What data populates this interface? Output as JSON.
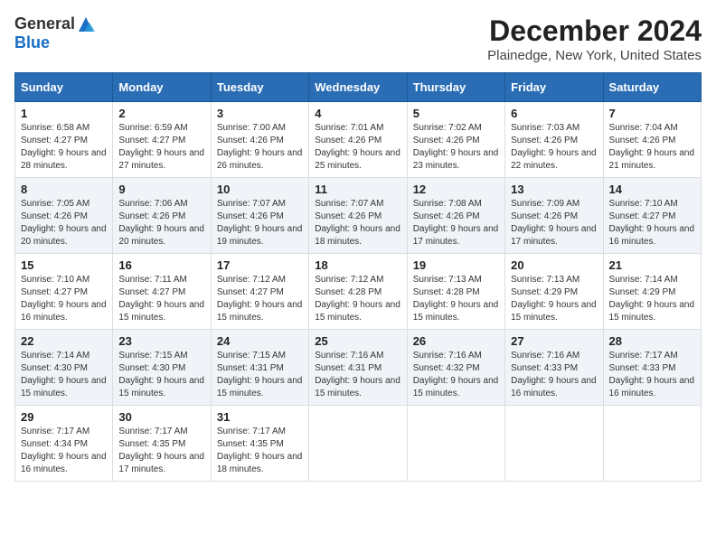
{
  "logo": {
    "general": "General",
    "blue": "Blue"
  },
  "title": "December 2024",
  "subtitle": "Plainedge, New York, United States",
  "days_of_week": [
    "Sunday",
    "Monday",
    "Tuesday",
    "Wednesday",
    "Thursday",
    "Friday",
    "Saturday"
  ],
  "weeks": [
    [
      {
        "day": "1",
        "sunrise": "6:58 AM",
        "sunset": "4:27 PM",
        "daylight": "9 hours and 28 minutes."
      },
      {
        "day": "2",
        "sunrise": "6:59 AM",
        "sunset": "4:27 PM",
        "daylight": "9 hours and 27 minutes."
      },
      {
        "day": "3",
        "sunrise": "7:00 AM",
        "sunset": "4:26 PM",
        "daylight": "9 hours and 26 minutes."
      },
      {
        "day": "4",
        "sunrise": "7:01 AM",
        "sunset": "4:26 PM",
        "daylight": "9 hours and 25 minutes."
      },
      {
        "day": "5",
        "sunrise": "7:02 AM",
        "sunset": "4:26 PM",
        "daylight": "9 hours and 23 minutes."
      },
      {
        "day": "6",
        "sunrise": "7:03 AM",
        "sunset": "4:26 PM",
        "daylight": "9 hours and 22 minutes."
      },
      {
        "day": "7",
        "sunrise": "7:04 AM",
        "sunset": "4:26 PM",
        "daylight": "9 hours and 21 minutes."
      }
    ],
    [
      {
        "day": "8",
        "sunrise": "7:05 AM",
        "sunset": "4:26 PM",
        "daylight": "9 hours and 20 minutes."
      },
      {
        "day": "9",
        "sunrise": "7:06 AM",
        "sunset": "4:26 PM",
        "daylight": "9 hours and 20 minutes."
      },
      {
        "day": "10",
        "sunrise": "7:07 AM",
        "sunset": "4:26 PM",
        "daylight": "9 hours and 19 minutes."
      },
      {
        "day": "11",
        "sunrise": "7:07 AM",
        "sunset": "4:26 PM",
        "daylight": "9 hours and 18 minutes."
      },
      {
        "day": "12",
        "sunrise": "7:08 AM",
        "sunset": "4:26 PM",
        "daylight": "9 hours and 17 minutes."
      },
      {
        "day": "13",
        "sunrise": "7:09 AM",
        "sunset": "4:26 PM",
        "daylight": "9 hours and 17 minutes."
      },
      {
        "day": "14",
        "sunrise": "7:10 AM",
        "sunset": "4:27 PM",
        "daylight": "9 hours and 16 minutes."
      }
    ],
    [
      {
        "day": "15",
        "sunrise": "7:10 AM",
        "sunset": "4:27 PM",
        "daylight": "9 hours and 16 minutes."
      },
      {
        "day": "16",
        "sunrise": "7:11 AM",
        "sunset": "4:27 PM",
        "daylight": "9 hours and 15 minutes."
      },
      {
        "day": "17",
        "sunrise": "7:12 AM",
        "sunset": "4:27 PM",
        "daylight": "9 hours and 15 minutes."
      },
      {
        "day": "18",
        "sunrise": "7:12 AM",
        "sunset": "4:28 PM",
        "daylight": "9 hours and 15 minutes."
      },
      {
        "day": "19",
        "sunrise": "7:13 AM",
        "sunset": "4:28 PM",
        "daylight": "9 hours and 15 minutes."
      },
      {
        "day": "20",
        "sunrise": "7:13 AM",
        "sunset": "4:29 PM",
        "daylight": "9 hours and 15 minutes."
      },
      {
        "day": "21",
        "sunrise": "7:14 AM",
        "sunset": "4:29 PM",
        "daylight": "9 hours and 15 minutes."
      }
    ],
    [
      {
        "day": "22",
        "sunrise": "7:14 AM",
        "sunset": "4:30 PM",
        "daylight": "9 hours and 15 minutes."
      },
      {
        "day": "23",
        "sunrise": "7:15 AM",
        "sunset": "4:30 PM",
        "daylight": "9 hours and 15 minutes."
      },
      {
        "day": "24",
        "sunrise": "7:15 AM",
        "sunset": "4:31 PM",
        "daylight": "9 hours and 15 minutes."
      },
      {
        "day": "25",
        "sunrise": "7:16 AM",
        "sunset": "4:31 PM",
        "daylight": "9 hours and 15 minutes."
      },
      {
        "day": "26",
        "sunrise": "7:16 AM",
        "sunset": "4:32 PM",
        "daylight": "9 hours and 15 minutes."
      },
      {
        "day": "27",
        "sunrise": "7:16 AM",
        "sunset": "4:33 PM",
        "daylight": "9 hours and 16 minutes."
      },
      {
        "day": "28",
        "sunrise": "7:17 AM",
        "sunset": "4:33 PM",
        "daylight": "9 hours and 16 minutes."
      }
    ],
    [
      {
        "day": "29",
        "sunrise": "7:17 AM",
        "sunset": "4:34 PM",
        "daylight": "9 hours and 16 minutes."
      },
      {
        "day": "30",
        "sunrise": "7:17 AM",
        "sunset": "4:35 PM",
        "daylight": "9 hours and 17 minutes."
      },
      {
        "day": "31",
        "sunrise": "7:17 AM",
        "sunset": "4:35 PM",
        "daylight": "9 hours and 18 minutes."
      },
      null,
      null,
      null,
      null
    ]
  ]
}
